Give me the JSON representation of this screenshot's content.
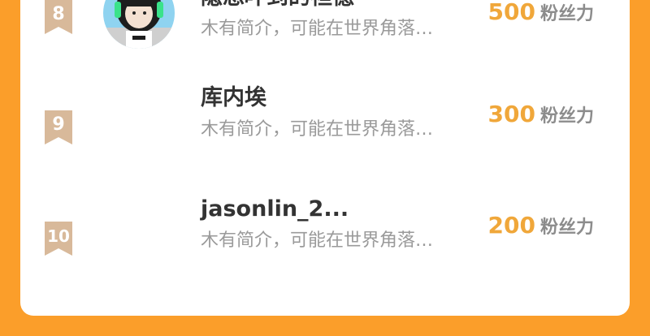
{
  "ranking": {
    "items": [
      {
        "rank": "8",
        "name": "隐想吓到的袒憶",
        "desc": "木有简介，可能在世界角落…",
        "fans_count": "500",
        "fans_label": "粉丝力",
        "has_avatar": true
      },
      {
        "rank": "9",
        "name": "库内埃",
        "desc": "木有简介，可能在世界角落…",
        "fans_count": "300",
        "fans_label": "粉丝力",
        "has_avatar": false
      },
      {
        "rank": "10",
        "name": "jasonlin_2...",
        "desc": "木有简介，可能在世界角落…",
        "fans_count": "200",
        "fans_label": "粉丝力",
        "has_avatar": false
      }
    ]
  },
  "colors": {
    "background": "#fb9e2a",
    "badge": "#d8b99a",
    "fans_count": "#f0a73a"
  }
}
